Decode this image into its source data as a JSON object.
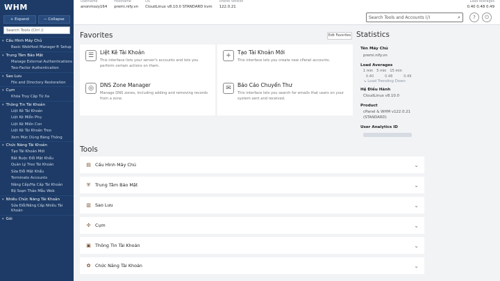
{
  "sidebar": {
    "logo": "WHM",
    "expand": "+ Expand",
    "collapse": "− Collapse",
    "search_placeholder": "Search Tools (Ctrl /)",
    "sections": [
      {
        "label": "Cấu Hình Máy Chủ",
        "items": [
          "Basic WebHost Manager® Setup"
        ]
      },
      {
        "label": "Trung Tâm Bảo Mật",
        "items": [
          "Manage External Authentications",
          "Two-Factor Authentication"
        ]
      },
      {
        "label": "Sao Lưu",
        "items": [
          "File and Directory Restoration"
        ]
      },
      {
        "label": "Cụm",
        "items": [
          "Khóa Truy Cập Từ Xa"
        ]
      },
      {
        "label": "Thông Tin Tài Khoản",
        "items": [
          "Liệt Kê Tài Khoản",
          "Liệt Kê Miễn Phụ",
          "Liệt Kê Miền Con",
          "Liệt Kê Tài Khoản Treo",
          "Xem Mức Dùng Băng Thông"
        ]
      },
      {
        "label": "Chức Năng Tài Khoản",
        "items": [
          "Tạo Tài Khoản Mới",
          "Bắt Buộc Đổi Mật Khẩu",
          "Quản Lý Treo Tài Khoản",
          "Sửa Đổi Mật Khẩu",
          "Terminate Accounts",
          "Nâng Cấp/Hạ Cấp Tài Khoản",
          "Bộ Soạn Thảo Mẫu Web"
        ]
      },
      {
        "label": "Nhiều Chức Năng Tài Khoản",
        "items": [
          "Sửa Đổi/Nâng Cấp Nhiều Tài Khoản"
        ]
      },
      {
        "label": "Gói",
        "items": []
      }
    ]
  },
  "topbar": {
    "info": [
      {
        "label": "Username",
        "value": "anonmozy164"
      },
      {
        "label": "Hostname",
        "value": "premi.nify.vn"
      },
      {
        "label": "OS",
        "value": "CloudLinux v8.10.0 STANDARD kvm"
      },
      {
        "label": "cPanel Version",
        "value": "122.0.21"
      }
    ],
    "load_label": "Load Averages",
    "load_values": "0.40  0.48  0.49",
    "search_placeholder": "Search Tools and Accounts (/)",
    "icons": [
      "search-icon",
      "help-icon",
      "power-icon"
    ]
  },
  "favorites": {
    "title": "Favorites",
    "edit_label": "Edit Favorites",
    "cards": [
      {
        "title": "Liệt Kê Tài Khoản",
        "desc": "This interface lists your server's accounts and lets you perform certain actions on them.",
        "icon": "list-icon"
      },
      {
        "title": "Tạo Tài Khoản Mới",
        "desc": "This interface lets you create new cPanel accounts.",
        "icon": "plus-icon"
      },
      {
        "title": "DNS Zone Manager",
        "desc": "Manage DNS zones, including adding and removing records from a zone.",
        "icon": "dns-icon"
      },
      {
        "title": "Báo Cáo Chuyển Thư",
        "desc": "This interface lets you search for emails that users on your system sent and received.",
        "icon": "mail-report-icon"
      }
    ]
  },
  "tools": {
    "title": "Tools",
    "rows": [
      {
        "label": "Cấu Hình Máy Chủ",
        "icon": "server-icon"
      },
      {
        "label": "Trung Tâm Bảo Mật",
        "icon": "shield-icon"
      },
      {
        "label": "Sao Lưu",
        "icon": "backup-icon"
      },
      {
        "label": "Cụm",
        "icon": "cluster-icon"
      },
      {
        "label": "Thông Tin Tài Khoản",
        "icon": "account-info-icon"
      },
      {
        "label": "Chức Năng Tài Khoản",
        "icon": "account-functions-icon"
      }
    ]
  },
  "statistics": {
    "title": "Statistics",
    "server_label": "Tên Máy Chủ",
    "server_value": "premi.nify.vn",
    "load_label": "Load Averages",
    "load_headers": [
      "1 min",
      "5 min",
      "15 min"
    ],
    "load_values": [
      "0.40",
      "0.48",
      "0.49"
    ],
    "load_trend": "Load Trending Down",
    "os_label": "Hệ Điều Hành",
    "os_value": "CloudLinux v8.10.0",
    "product_label": "Product",
    "product_value": "cPanel & WHM v122.0.21 (STANDARD)",
    "analytics_label": "User Analytics ID"
  }
}
